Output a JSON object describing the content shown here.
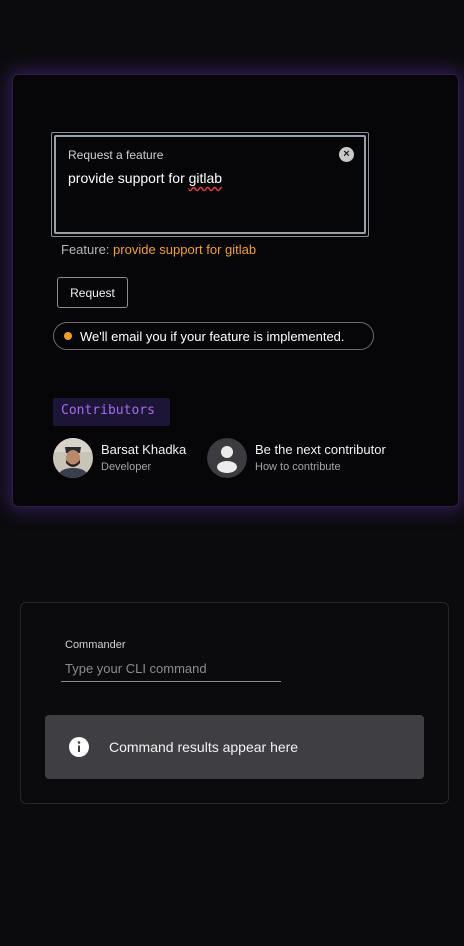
{
  "feature_request": {
    "label": "Request a feature",
    "value_plain": "provide support for ",
    "value_misspelled": "gitlab",
    "feature_prefix": "Feature:",
    "feature_value": "provide support for gitlab",
    "request_button": "Request",
    "notice": "We'll email you if your feature is implemented.",
    "notice_dot_color": "#f0a020"
  },
  "contributors": {
    "heading": "Contributors",
    "people": [
      {
        "name": "Barsat Khadka",
        "role": "Developer",
        "avatar": "profile-photo"
      },
      {
        "name": "Be the next contributor",
        "role": "How to contribute",
        "avatar": "person-icon"
      }
    ]
  },
  "commander": {
    "label": "Commander",
    "placeholder": "Type your CLI command",
    "result_text": "Command results appear here",
    "result_icon": "info-icon"
  },
  "colors": {
    "accent_orange": "#f0a030",
    "accent_purple": "#a46cf0",
    "glow": "#7a3cdc"
  }
}
